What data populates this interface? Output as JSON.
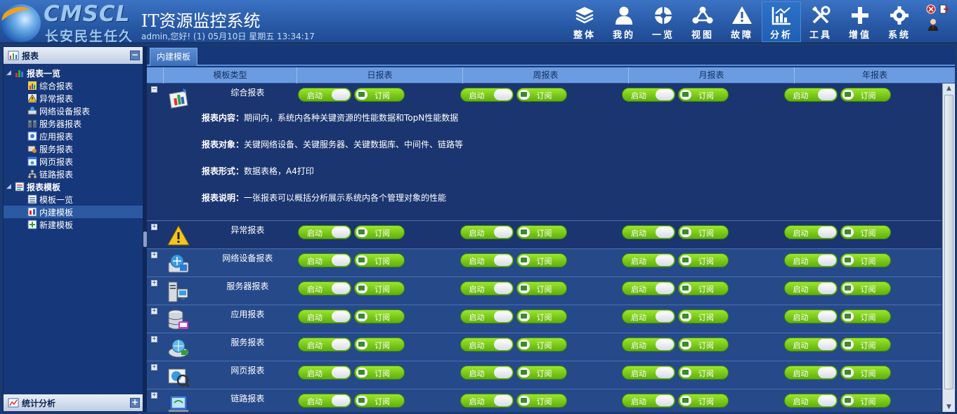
{
  "header": {
    "logo_brand": "CMSCL",
    "logo_slogan": "长安民生任久",
    "app_title": "IT资源监控系统",
    "user_info": "admin,您好! (1) 05月10日 星期五 13:34:17"
  },
  "nav": [
    {
      "label": "整体",
      "icon": "layers-icon"
    },
    {
      "label": "我的",
      "icon": "user-icon"
    },
    {
      "label": "一览",
      "icon": "dashboard-icon"
    },
    {
      "label": "视图",
      "icon": "topology-icon"
    },
    {
      "label": "故障",
      "icon": "warning-icon"
    },
    {
      "label": "分析",
      "icon": "chart-icon",
      "active": true
    },
    {
      "label": "工具",
      "icon": "tools-icon"
    },
    {
      "label": "增值",
      "icon": "plus-icon"
    },
    {
      "label": "系统",
      "icon": "gear-icon"
    }
  ],
  "sidebar": {
    "panel_title": "报表",
    "footer_title": "统计分析",
    "tree": [
      {
        "label": "报表一览",
        "level": 0
      },
      {
        "label": "综合报表",
        "level": 1
      },
      {
        "label": "异常报表",
        "level": 1
      },
      {
        "label": "网络设备报表",
        "level": 1
      },
      {
        "label": "服务器报表",
        "level": 1
      },
      {
        "label": "应用报表",
        "level": 1
      },
      {
        "label": "服务报表",
        "level": 1
      },
      {
        "label": "网页报表",
        "level": 1
      },
      {
        "label": "链路报表",
        "level": 1
      },
      {
        "label": "报表模板",
        "level": 0
      },
      {
        "label": "模板一览",
        "level": 1
      },
      {
        "label": "内建模板",
        "level": 1,
        "selected": true
      },
      {
        "label": "新建模板",
        "level": 1
      }
    ]
  },
  "main": {
    "tab_label": "内建模板",
    "columns": [
      "模板类型",
      "日报表",
      "周报表",
      "月报表",
      "年报表"
    ],
    "start_label": "启动",
    "subscribe_label": "订阅",
    "rows": [
      {
        "name": "综合报表",
        "icon": "comprehensive-report-icon",
        "expanded": true
      },
      {
        "name": "异常报表",
        "icon": "warning-icon"
      },
      {
        "name": "网络设备报表",
        "icon": "network-device-icon"
      },
      {
        "name": "服务器报表",
        "icon": "server-icon"
      },
      {
        "name": "应用报表",
        "icon": "database-icon"
      },
      {
        "name": "服务报表",
        "icon": "service-icon"
      },
      {
        "name": "网页报表",
        "icon": "webpage-icon"
      },
      {
        "name": "链路报表",
        "icon": "link-icon"
      }
    ],
    "detail": {
      "content_label": "报表内容：",
      "content_value": "期间内，系统内各种关键资源的性能数据和TopN性能数据",
      "object_label": "报表对象：",
      "object_value": "关键网络设备、关键服务器、关键数据库、中间件、链路等",
      "form_label": "报表形式：",
      "form_value": "数据表格，A4打印",
      "note_label": "报表说明：",
      "note_value": "一张报表可以概括分析展示系统内各个管理对象的性能"
    }
  },
  "colors": {
    "header_bg": "#2a5ba8",
    "body_bg": "#1a3a72",
    "grid_header": "#6b9be0",
    "button_green": "#7ccb1e"
  }
}
